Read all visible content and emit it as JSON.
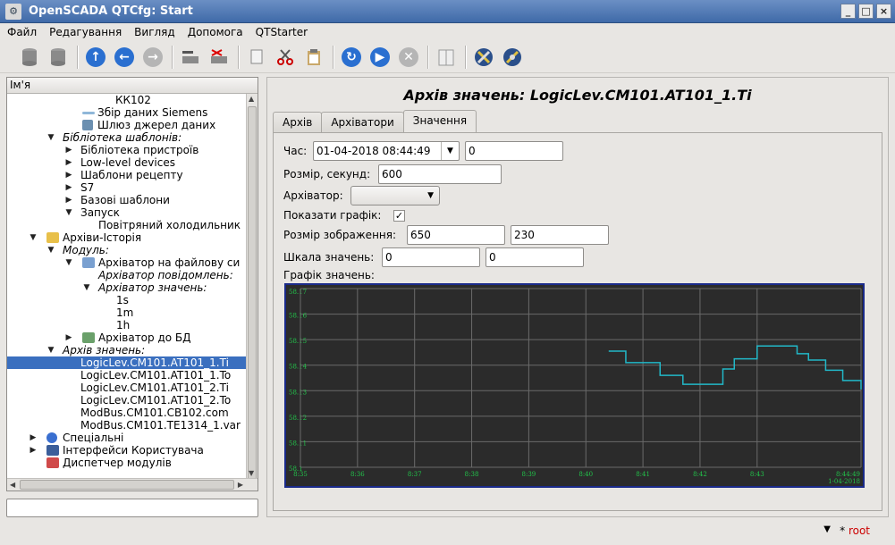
{
  "window": {
    "title": "OpenSCADA QTCfg: Start",
    "buttons": [
      "_",
      "□",
      "×"
    ]
  },
  "menu": [
    "Файл",
    "Редагування",
    "Вигляд",
    "Допомога",
    "QTStarter"
  ],
  "tree": {
    "header": "Ім'я",
    "rows": [
      {
        "label": "КК102",
        "indent": 121
      },
      {
        "label": "Збір даних Siemens",
        "indent": 101
      },
      {
        "label": "Шлюз джерел даних",
        "indent": 101
      },
      {
        "label": "Бібліотека шаблонів:",
        "indent": 62
      },
      {
        "label": "Бібліотека пристроїв",
        "indent": 82
      },
      {
        "label": "Low-level devices",
        "indent": 82
      },
      {
        "label": "Шаблони рецепту",
        "indent": 82
      },
      {
        "label": "S7",
        "indent": 82
      },
      {
        "label": "Базові шаблони",
        "indent": 82
      },
      {
        "label": "Запуск",
        "indent": 82
      },
      {
        "label": "Повітряний холодильник",
        "indent": 102
      },
      {
        "label": "Архіви-Історія",
        "indent": 62
      },
      {
        "label": "Модуль:",
        "indent": 62
      },
      {
        "label": "Архіватор на файлову си",
        "indent": 102
      },
      {
        "label": "Архіватор повідомлень:",
        "indent": 102
      },
      {
        "label": "Архіватор значень:",
        "indent": 102
      },
      {
        "label": "1s",
        "indent": 122
      },
      {
        "label": "1m",
        "indent": 122
      },
      {
        "label": "1h",
        "indent": 122
      },
      {
        "label": "Архіватор до БД",
        "indent": 102
      },
      {
        "label": "Архів значень:",
        "indent": 62
      },
      {
        "label": "LogicLev.CM101.AT101_1.Ti",
        "indent": 82
      },
      {
        "label": "LogicLev.CM101.AT101_1.To",
        "indent": 82
      },
      {
        "label": "LogicLev.CM101.AT101_2.Ti",
        "indent": 82
      },
      {
        "label": "LogicLev.CM101.AT101_2.To",
        "indent": 82
      },
      {
        "label": "ModBus.CM101.CB102.com",
        "indent": 82
      },
      {
        "label": "ModBus.CM101.TE1314_1.var",
        "indent": 82
      },
      {
        "label": "Спеціальні",
        "indent": 62
      },
      {
        "label": "Інтерфейси Користувача",
        "indent": 62
      },
      {
        "label": "Диспетчер модулів",
        "indent": 62
      }
    ]
  },
  "page": {
    "title": "Архів значень: LogicLev.CM101.AT101_1.Ti",
    "tabs": [
      "Архів",
      "Архіватори",
      "Значення"
    ],
    "form": {
      "time_label": "Час:",
      "time_value": "01-04-2018 08:44:49",
      "time_offset": "0",
      "size_label": "Розмір, секунд:",
      "size_value": "600",
      "archiver_label": "Архіватор:",
      "show_graph_label": "Показати графік:",
      "show_graph_checked": "✓",
      "img_size_label": "Розмір зображення:",
      "img_width": "650",
      "img_height": "230",
      "scale_label": "Шкала значень:",
      "scale_min": "0",
      "scale_max": "0",
      "graph_label": "Графік значень:"
    }
  },
  "chart_data": {
    "type": "line",
    "ylim": [
      58.1,
      58.17
    ],
    "y_ticks": [
      "58.17",
      "58.16",
      "58.15",
      "58.14",
      "58.13",
      "58.12",
      "58.11",
      "58.1"
    ],
    "x_ticks": [
      "8:35",
      "8:36",
      "8:37",
      "8:38",
      "8:39",
      "8:40",
      "8:41",
      "8:42",
      "8:43",
      "8:44:49"
    ],
    "x_date": "1-04-2018",
    "series": [
      {
        "color": "#22b8c8",
        "x": [
          40.4,
          40.6,
          40.7,
          41.0,
          41.1,
          41.3,
          41.5,
          41.6,
          41.7,
          42.0,
          42.2,
          42.4,
          42.5,
          42.6,
          42.7,
          43.0,
          43.2,
          43.4,
          43.7,
          43.9,
          44.2,
          44.5,
          44.82
        ],
        "y": [
          58.1455,
          58.1455,
          58.141,
          58.141,
          58.141,
          58.136,
          58.136,
          58.136,
          58.1325,
          58.1325,
          58.1325,
          58.1385,
          58.1385,
          58.1425,
          58.1425,
          58.1475,
          58.1475,
          58.1475,
          58.1445,
          58.142,
          58.138,
          58.134,
          58.1305
        ]
      }
    ]
  },
  "status": {
    "user_prefix": "*",
    "user": "root"
  }
}
